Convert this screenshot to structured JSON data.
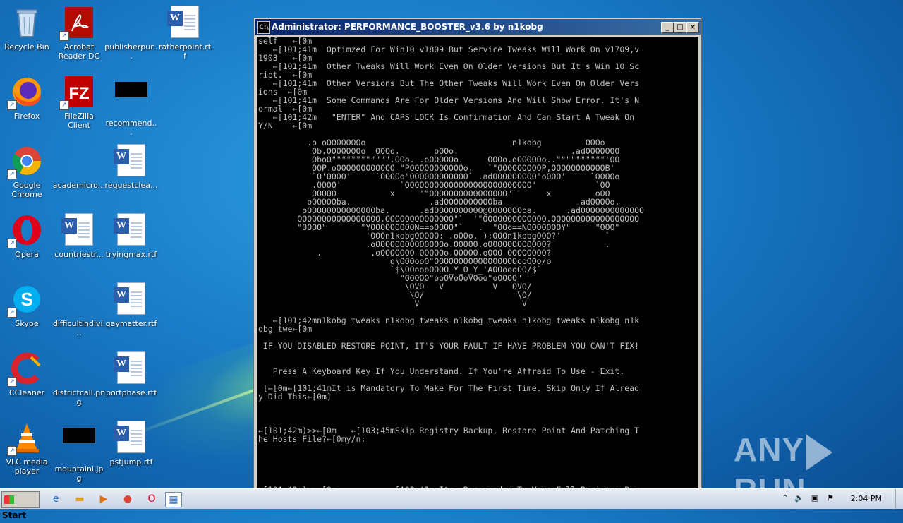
{
  "desktop_icons": [
    {
      "label": "Recycle Bin"
    },
    {
      "label": "Acrobat Reader DC"
    },
    {
      "label": "publisherpur..."
    },
    {
      "label": "ratherpoint.rtf"
    },
    {
      "label": "Firefox"
    },
    {
      "label": "FileZilla Client"
    },
    {
      "label": "recommend..."
    },
    {
      "label": "Google Chrome"
    },
    {
      "label": "academicro..."
    },
    {
      "label": "requestclea..."
    },
    {
      "label": "Opera"
    },
    {
      "label": "countriestr..."
    },
    {
      "label": "tryingmax.rtf"
    },
    {
      "label": "Skype"
    },
    {
      "label": "difficultindivi..."
    },
    {
      "label": "gaymatter.rtf"
    },
    {
      "label": "CCleaner"
    },
    {
      "label": "districtcall.png"
    },
    {
      "label": "portphase.rtf"
    },
    {
      "label": "VLC media player"
    },
    {
      "label": "mountainl.jpg"
    },
    {
      "label": "pstjump.rtf"
    }
  ],
  "console": {
    "title": "Administrator:  PERFORMANCE_BOOSTER_v3.6 by n1kobg",
    "minimize": "_",
    "maximize": "□",
    "close": "×",
    "header_text": "self   ←[0m\n   ←[101;41m  Optimzed For Win10 v1809 But Service Tweaks Will Work On v1709,v\n1903   ←[0m\n   ←[101;41m  Other Tweaks Will Work Even On Older Versions But It's Win 10 Sc\nript.  ←[0m\n   ←[101;41m  Other Versions But The Other Tweaks Will Work Even On Older Vers\nions  ←[0m\n   ←[101;41m  Some Commands Are For Older Versions And Will Show Error. It's N\normal  ←[0m\n   ←[101;42m   \"ENTER\" And CAPS LOCK Is Confirmation And Can Start A Tweak On\nY/N    ←[0m",
    "ascii_art": "\n          .o oOOOOOOOo                              n1kobg         OOOo\n           Ob.OOOOOOOo  OOOo.       oOOo.                       .adOOOOOOO\n           OboO\"\"\"\"\"\"\"\"\"\"\"\".OOo. .oOOOOOo.     OOOo.oOOOOOo..\"\"\"\"\"\"\"\"\"\"'OO\n           OOP.oOOOOOOOOOOOO \"POOOOOOOOOOOo.   `\"OOOOOOOOOP,OOOOOOOOOOOB'\n           `O'OOOO'     `OOOOo\"OOOOOOOOOOOO` .adOOOOOOOOO\"oOOO'     `OOOOo\n           .OOOO'            `OOOOOOOOOOOOOOOOOOOOOOOOOO'            `OO\n           OOOOO           x     '\"OOOOOOOOOOOOOOOO\"`      x         oOO\n          oOOOOOba.                .adOOOOOOOOOOba               .adOOOOo.\n         oOOOOOOOOOOOOOOba.      .adOOOOOOOOOO@OOOOOOOba.      .adOOOOOOOOOOOOO\n        OOOOOOOOOOOOOOOOO.OOOOOOOOOOOOOO\"`  '\"OOOOOOOOOOOOO.OOOOOOOOOOOOOOOOOO\n        \"OOOO\"       \"YOOOOOOOOON==oOOOO\"`   .  \"OOo==NOOOOOOOY\"     \"OOO\"\n                      'OOOn1kobgOOOOO: .oOOo. ):OOOn1kobgOOO?'         `\n                      .oOOOOOOOOOOOOOOo.OOOOO.oOOOOOOOOOOOO?           .\n            .          .oOOOOOOO OOOOOo.OOOOO.oOOO OOOOOOOO?\n                           o\\OOOooO\"OOOOOOOOOOOOOOOOOooOOo/o\n                           `$\\OOoooOOOO_Y_O_Y_'AOOoooOO/$`\n                             \"OOOOO\"ooOVoOoVOoo\"oOOOO\"\n                              \\OVO   V          V   OVO/\n                               \\O/                   \\O/\n                                V                     V",
    "footer_text": "\n   ←[101;42mn1kobg tweaks n1kobg tweaks n1kobg tweaks n1kobg tweaks n1kobg n1k\nobg twe←[0m\n\n IF YOU DISABLED RESTORE POINT, IT'S YOUR FAULT IF HAVE PROBLEM YOU CAN'T FIX!\n\n\n   Press A Keyboard Key If You Understand. If You're Affraid To Use - Exit.\n\n [←[0m←[101;41mIt is Mandatory To Make For The First Time. Skip Only If Alread\ny Did This←[0m]\n\n\n\n←[101;42m)>>←[0m   ←[103;45mSkip Registry Backup, Restore Point And Patching T\nhe Hosts File?←[0my/n:\n\n\n\n\n\n←[101;42m)>>←[0m           ←[103;41m It's Recomended To Make Full Registry Bac\nkup? ←[0m y/n: a"
  },
  "watermark": {
    "left": "ANY",
    "right": "RUN"
  },
  "taskbar": {
    "start_label": "Start",
    "clock": "2:04 PM"
  }
}
